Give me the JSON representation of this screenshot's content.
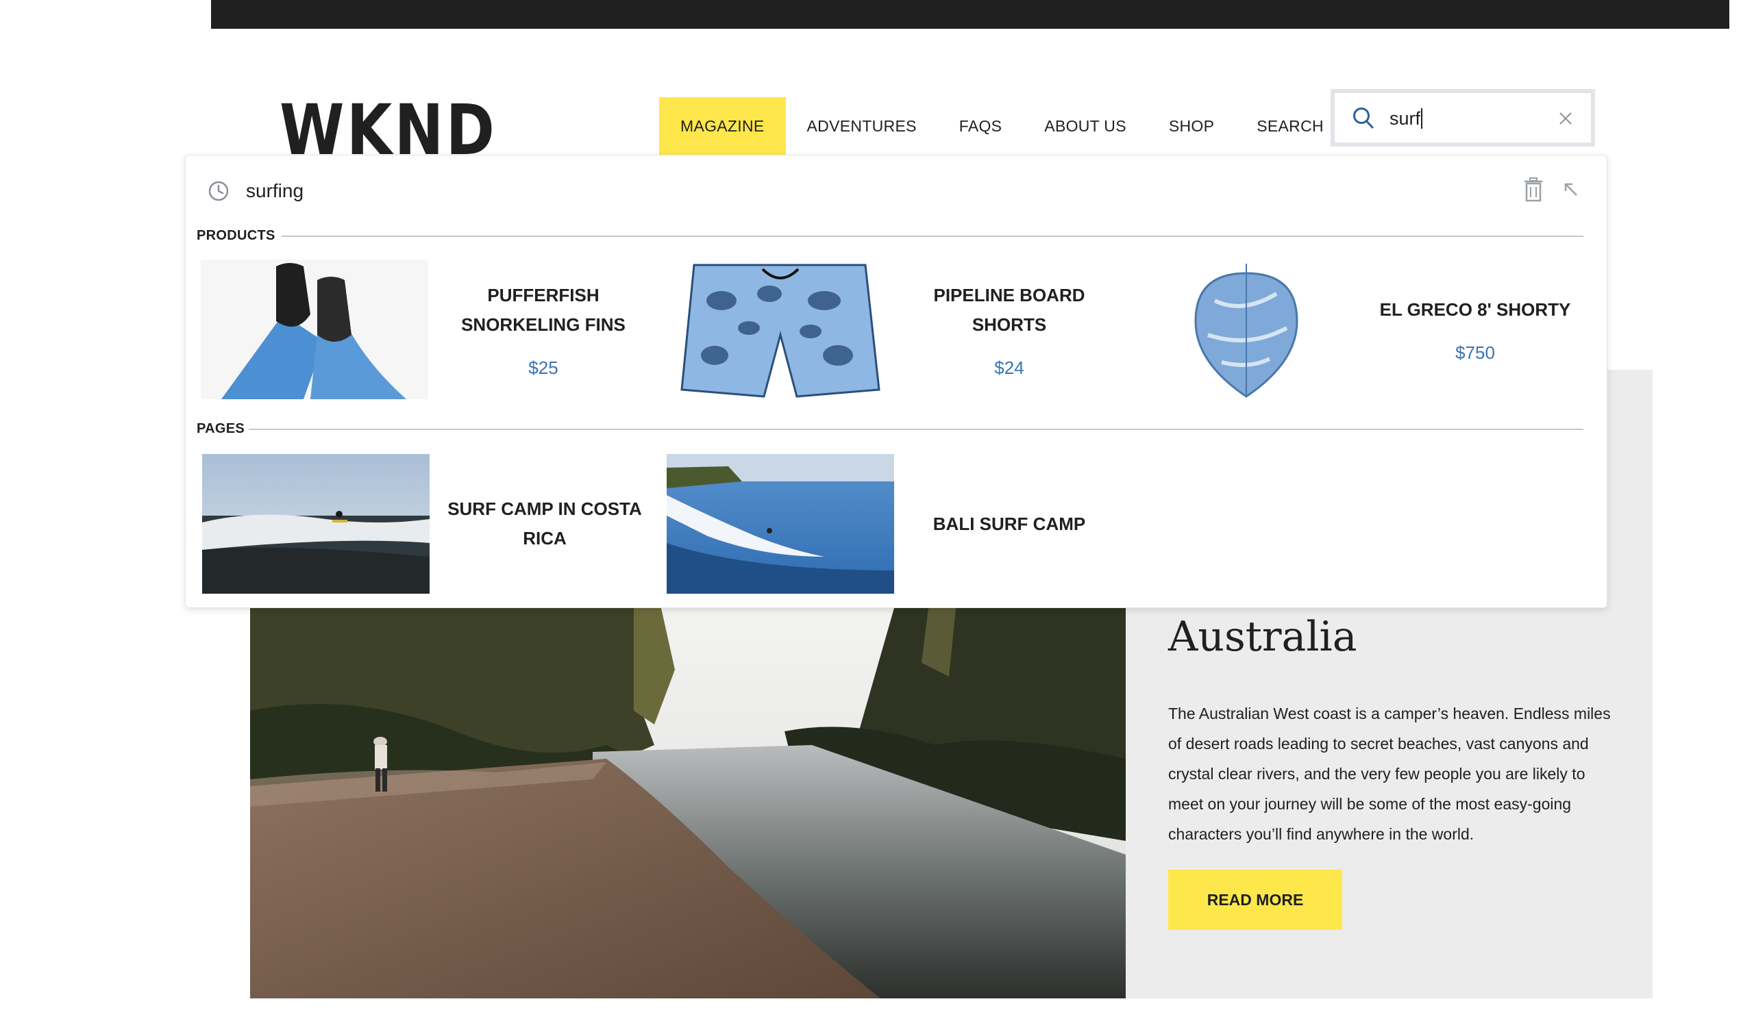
{
  "header": {
    "logo": "WKND",
    "nav": [
      {
        "label": "MAGAZINE",
        "active": true
      },
      {
        "label": "ADVENTURES",
        "active": false
      },
      {
        "label": "FAQS",
        "active": false
      },
      {
        "label": "ABOUT US",
        "active": false
      },
      {
        "label": "SHOP",
        "active": false
      },
      {
        "label": "SEARCH",
        "active": false
      }
    ],
    "search": {
      "value": "surf",
      "icon": "search-icon",
      "clear_icon": "close-icon"
    }
  },
  "autocomplete": {
    "recent": {
      "text": "surfing",
      "icon": "clock-icon",
      "delete_icon": "trash-icon",
      "collapse_icon": "arrow-up-left-icon"
    },
    "products_label": "PRODUCTS",
    "products": [
      {
        "name": "PUFFERFISH SNORKELING FINS",
        "price": "$25"
      },
      {
        "name": "PIPELINE BOARD SHORTS",
        "price": "$24"
      },
      {
        "name": "EL GRECO 8' SHORTY",
        "price": "$750"
      }
    ],
    "pages_label": "PAGES",
    "pages": [
      {
        "name": "SURF CAMP IN COSTA RICA"
      },
      {
        "name": "BALI SURF CAMP"
      }
    ]
  },
  "hero": {
    "title": "Australia",
    "text": "The Australian West coast is a camper’s heaven. Endless miles of desert roads leading to secret beaches, vast canyons and crystal clear rivers, and the very few people you are likely to meet on your journey will be some of the most easy-going characters you’ll find anywhere in the world.",
    "button": "READ MORE"
  },
  "colors": {
    "accent": "#fee74b",
    "price": "#3b74b0",
    "dark": "#202020",
    "panel": "#ececec"
  }
}
